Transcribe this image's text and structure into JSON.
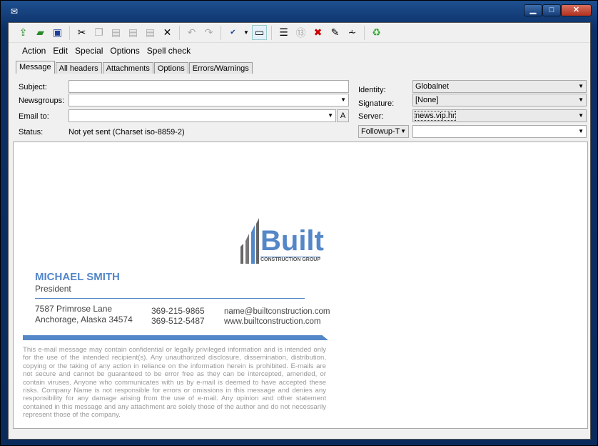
{
  "window": {
    "icon": "envelope-icon",
    "controls": {
      "minimize": "▁",
      "maximize": "□",
      "close": "✕"
    }
  },
  "toolbar": [
    "send-icon",
    "send-later-icon",
    "save-icon",
    "cut-icon",
    "copy-icon",
    "paste-icon",
    "paste-quoted-icon",
    "paste-special-icon",
    "delete-icon",
    "undo-icon",
    "redo-icon",
    "spellcheck-icon",
    "rot13-icon",
    "wrap-icon",
    "rot13-circle-icon",
    "cancel-icon",
    "signature-icon",
    "reformat-icon",
    "trash-icon"
  ],
  "menu": [
    "Action",
    "Edit",
    "Special",
    "Options",
    "Spell check"
  ],
  "tabs": [
    "Message",
    "All headers",
    "Attachments",
    "Options",
    "Errors/Warnings"
  ],
  "form": {
    "subject_label": "Subject:",
    "subject": "",
    "newsgroups_label": "Newsgroups:",
    "newsgroups": "",
    "emailto_label": "Email to:",
    "emailto": "",
    "address_btn": "A",
    "status_label": "Status:",
    "status": "Not yet sent (Charset iso-8859-2)",
    "identity_label": "Identity:",
    "identity": "Globalnet",
    "signature_label": "Signature:",
    "signature": "[None]",
    "server_label": "Server:",
    "server": "news.vip.hr",
    "followup": "Followup-T",
    "followup_value": ""
  },
  "signature": {
    "logo_word": "Built",
    "logo_sub": "CONSTRUCTION GROUP",
    "name": "MICHAEL SMITH",
    "title": "President",
    "address1": "7587 Primrose Lane",
    "address2": "Anchorage, Alaska 34574",
    "phone1": "369-215-9865",
    "phone2": "369-512-5487",
    "email": "name@builtconstruction.com",
    "web": "www.builtconstruction.com",
    "disclaimer": "This e-mail message may contain confidential or legally privileged information and is intended only for the use of the intended recipient(s). Any unauthorized disclosure, dissemination, distribution, copying or the taking of any action in reliance on the information herein is prohibited. E-mails are not secure and cannot be guaranteed to be error free as they can be intercepted, amended, or contain viruses. Anyone who communicates with us by e-mail is deemed to have accepted these risks. Company Name is not responsible for errors or omissions in this message and denies any responsibility for any damage arising from the use of e-mail. Any opinion and other statement contained in this message and any attachment are solely those of the author and do not necessarily represent those of the company.",
    "accent": "#5487c8"
  }
}
